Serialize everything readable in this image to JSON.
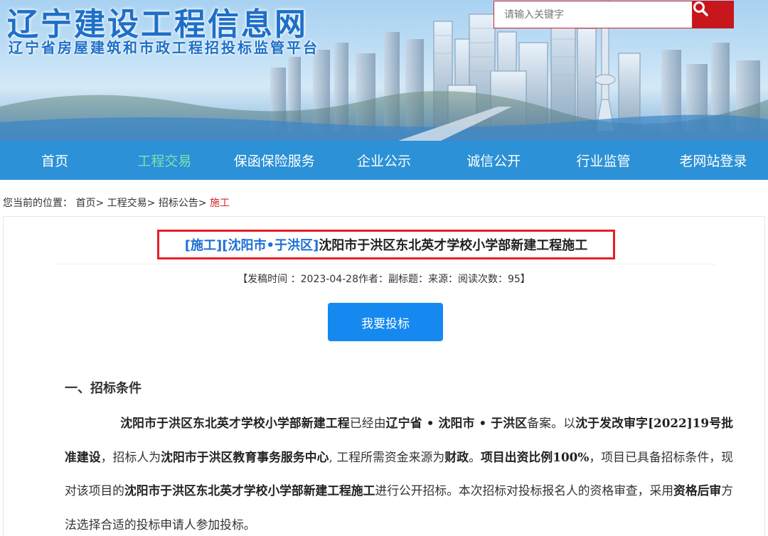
{
  "header": {
    "site_title": "辽宁建设工程信息网",
    "site_subtitle": "辽宁省房屋建筑和市政工程招投标监管平台",
    "search_placeholder": "请输入关键字",
    "search_icon": "search-icon"
  },
  "nav": {
    "items": [
      {
        "label": "首页"
      },
      {
        "label": "工程交易",
        "active": true
      },
      {
        "label": "保函保险服务"
      },
      {
        "label": "企业公示"
      },
      {
        "label": "诚信公开"
      },
      {
        "label": "行业监管"
      },
      {
        "label": "老网站登录"
      }
    ]
  },
  "breadcrumb": {
    "prefix": "您当前的位置：",
    "items": [
      "首页>",
      "工程交易>",
      "招标公告>"
    ],
    "current": "施工"
  },
  "article": {
    "tag_type": "[施工]",
    "tag_region": "[沈阳市•于洪区]",
    "title": "沈阳市于洪区东北英才学校小学部新建工程施工",
    "meta": "【发稿时间 ：2023-04-28作者：副标题：来源：阅读次数：95】",
    "bid_button": "我要投标",
    "section1_heading": "一、招标条件",
    "p1": "沈阳市于洪区东北英才学校小学部新建工程",
    "p2": "已经由",
    "p3": "辽宁省 • 沈阳市 • 于洪区",
    "p4": "备案。以",
    "p5": "沈于发改审字[2022]19号批准建设",
    "p6": "，招标人为",
    "p7": "沈阳市于洪区教育事务服务中心",
    "p8": ", 工程所需资金来源为",
    "p9": "财政",
    "p10": "。",
    "p11": "项目出资比例100%",
    "p12": "，项目已具备招标条件，现对该项目的",
    "p13": "沈阳市于洪区东北英才学校小学部新建工程施工",
    "p14": "进行公开招标。本次招标对投标报名人的资格审查，采用",
    "p15": "资格后审",
    "p16": "方法选择合适的投标申请人参加投标。"
  },
  "colors": {
    "nav_bg": "#2c91d6",
    "nav_active": "#7de0b0",
    "brand_blue": "#1e6fc8",
    "search_red": "#c8161d",
    "title_border": "#e4202a",
    "tag_blue": "#1d6fd6",
    "button_blue": "#1589f0"
  }
}
